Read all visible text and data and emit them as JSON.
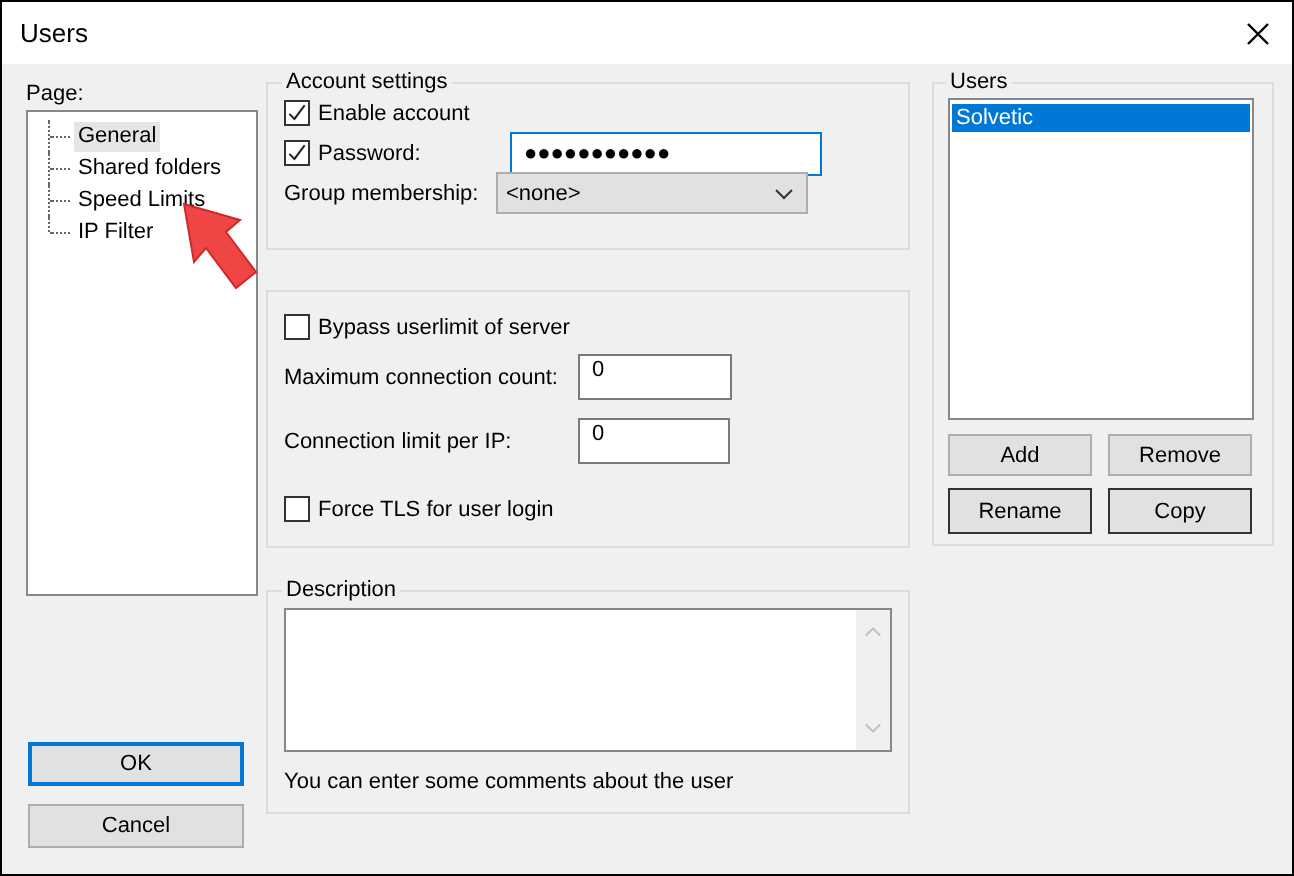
{
  "window": {
    "title": "Users"
  },
  "page_tree": {
    "label": "Page:",
    "items": [
      {
        "label": "General",
        "selected": true
      },
      {
        "label": "Shared folders",
        "selected": false
      },
      {
        "label": "Speed Limits",
        "selected": false
      },
      {
        "label": "IP Filter",
        "selected": false
      }
    ]
  },
  "account_settings": {
    "title": "Account settings",
    "enable_account": {
      "label": "Enable account",
      "checked": true
    },
    "password": {
      "label": "Password:",
      "checked": true,
      "value": "●●●●●●●●●●●"
    },
    "group_membership": {
      "label": "Group membership:",
      "value": "<none>"
    }
  },
  "limits": {
    "bypass": {
      "label": "Bypass userlimit of server",
      "checked": false
    },
    "max_connections": {
      "label": "Maximum connection count:",
      "value": "0"
    },
    "per_ip": {
      "label": "Connection limit per IP:",
      "value": "0"
    },
    "force_tls": {
      "label": "Force TLS for user login",
      "checked": false
    }
  },
  "description": {
    "title": "Description",
    "hint": "You can enter some comments about the user"
  },
  "users": {
    "title": "Users",
    "items": [
      {
        "label": "Solvetic",
        "selected": true
      }
    ],
    "buttons": [
      "Add",
      "Remove",
      "Rename",
      "Copy"
    ]
  },
  "dialog_buttons": [
    "OK",
    "Cancel"
  ]
}
